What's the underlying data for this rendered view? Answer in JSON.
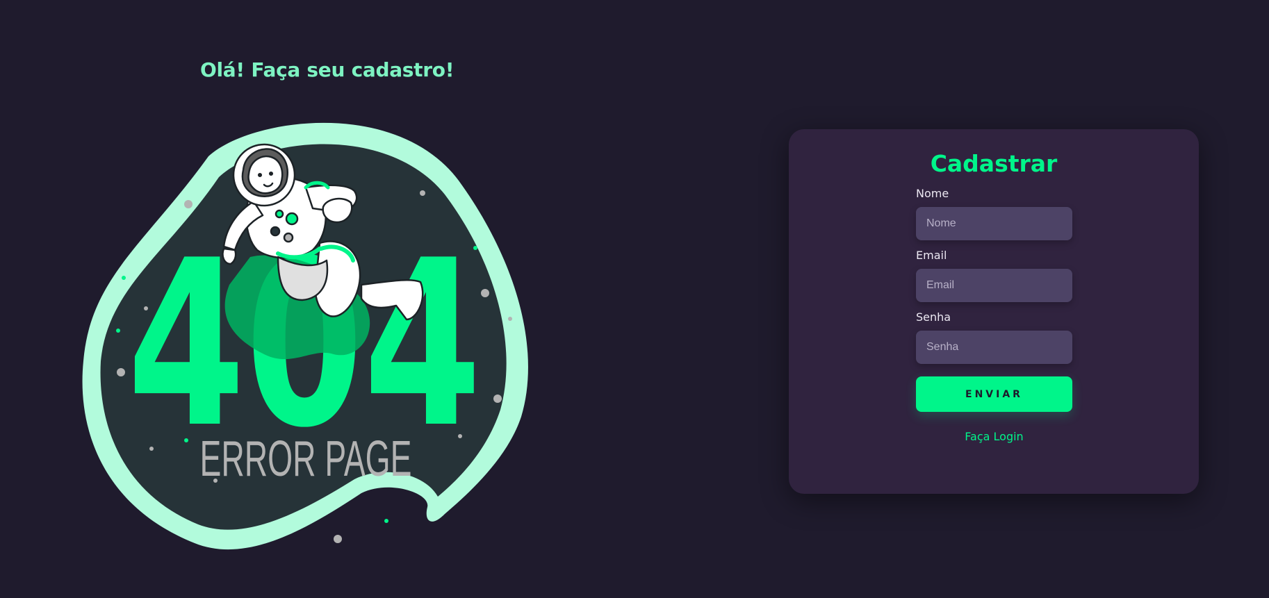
{
  "colors": {
    "background": "#1f1b2d",
    "accent": "#00f58a",
    "mint": "#b2fbdc",
    "card": "#30233f",
    "input": "#4d4366"
  },
  "heading": "Olá! Faça seu cadastro!",
  "illustration": {
    "big_text": "404",
    "sub_text": "ERROR PAGE"
  },
  "form": {
    "title": "Cadastrar",
    "name": {
      "label": "Nome",
      "placeholder": "Nome",
      "value": ""
    },
    "email": {
      "label": "Email",
      "placeholder": "Email",
      "value": ""
    },
    "password": {
      "label": "Senha",
      "placeholder": "Senha",
      "value": ""
    },
    "submit_label": "ENVIAR",
    "login_link": "Faça Login"
  }
}
